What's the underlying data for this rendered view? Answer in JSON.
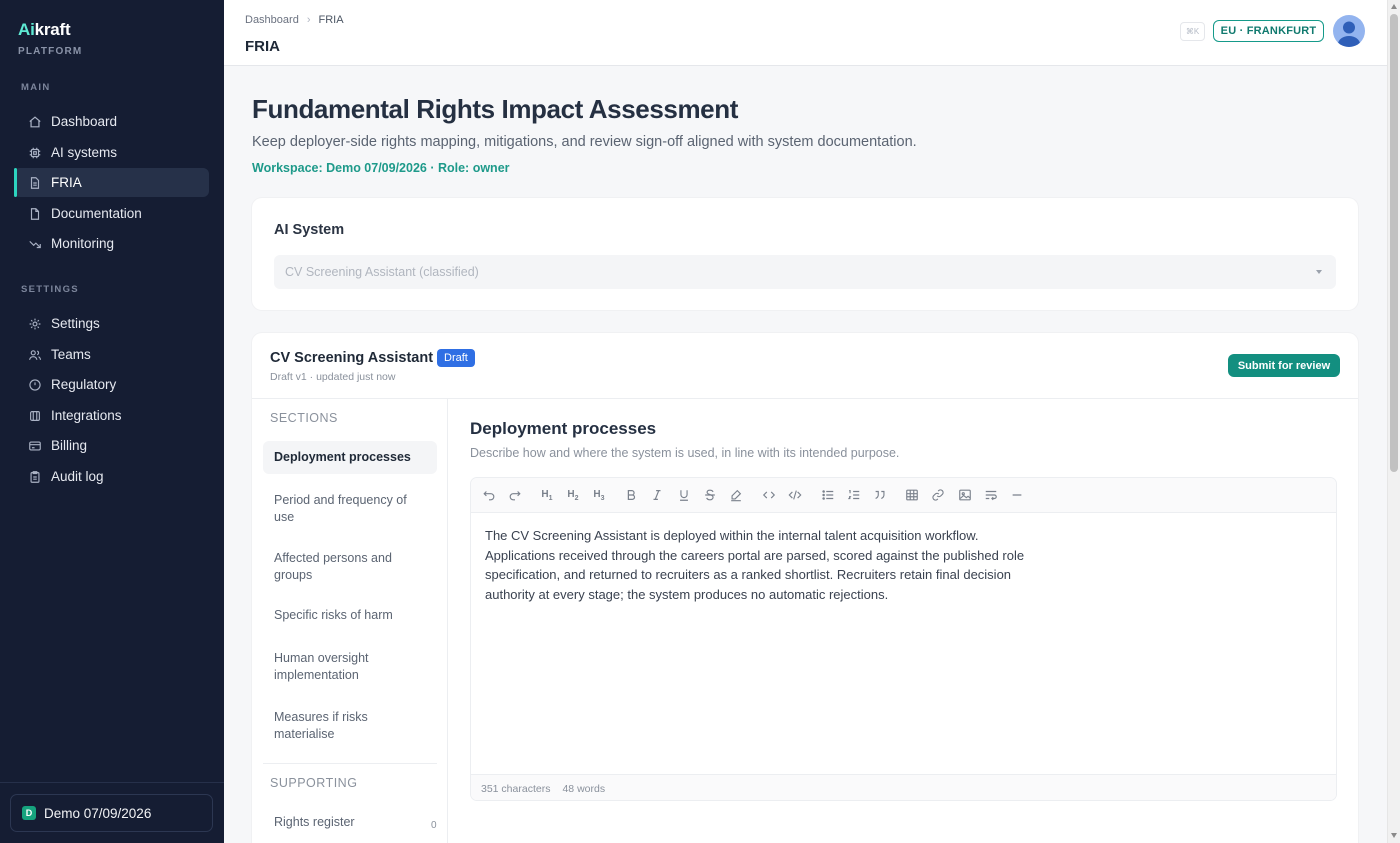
{
  "sidebar": {
    "brand_accent": "Ai",
    "brand_rest": "kraft",
    "brand_sub": "PLATFORM",
    "main_label": "MAIN",
    "main_items": [
      {
        "label": "Dashboard",
        "icon": "home-icon"
      },
      {
        "label": "AI systems",
        "icon": "cpu-icon"
      },
      {
        "label": "FRIA",
        "icon": "file-icon",
        "active": true
      },
      {
        "label": "Documentation",
        "icon": "document-icon"
      },
      {
        "label": "Monitoring",
        "icon": "trend-down-icon"
      }
    ],
    "settings_label": "SETTINGS",
    "settings_items": [
      {
        "label": "Settings",
        "icon": "gear-icon"
      },
      {
        "label": "Teams",
        "icon": "users-icon"
      },
      {
        "label": "Regulatory",
        "icon": "clock-icon"
      },
      {
        "label": "Integrations",
        "icon": "plug-icon"
      },
      {
        "label": "Billing",
        "icon": "card-icon"
      },
      {
        "label": "Audit log",
        "icon": "clipboard-icon"
      }
    ],
    "workspace_badge": "D",
    "workspace_name": "Demo 07/09/2026"
  },
  "topbar": {
    "breadcrumb": [
      "Dashboard",
      "FRIA"
    ],
    "title": "FRIA",
    "shortcut": "⌘K",
    "region": "EU · FRANKFURT"
  },
  "page": {
    "title": "Fundamental Rights Impact Assessment",
    "subtitle": "Keep deployer-side rights mapping, mitigations, and review sign-off aligned with system documentation.",
    "meta": "Workspace: Demo 07/09/2026 · Role: owner"
  },
  "system": {
    "label": "AI System",
    "selected": "CV Screening Assistant (classified)"
  },
  "assessment": {
    "name": "CV Screening Assistant",
    "status": "Draft",
    "version": "Draft v1 · updated just now",
    "submit_label": "Submit for review",
    "sections_label": "SECTIONS",
    "sections": [
      "Deployment processes",
      "Period and frequency of use",
      "Affected persons and groups",
      "Specific risks of harm",
      "Human oversight implementation",
      "Measures if risks materialise"
    ],
    "supporting_label": "SUPPORTING",
    "supporting": [
      {
        "label": "Rights register",
        "count": "0"
      }
    ]
  },
  "editor": {
    "title": "Deployment processes",
    "description": "Describe how and where the system is used, in line with its intended purpose.",
    "content": "The CV Screening Assistant is deployed within the internal talent acquisition workflow. Applications received through the careers portal are parsed, scored against the published role specification, and returned to recruiters as a ranked shortlist. Recruiters retain final decision authority at every stage; the system produces no automatic rejections.",
    "characters": "351 characters",
    "words": "48 words"
  },
  "colors": {
    "sidebar_bg": "#151d33",
    "accent_teal": "#138f80",
    "draft_blue": "#2f6fe4"
  }
}
